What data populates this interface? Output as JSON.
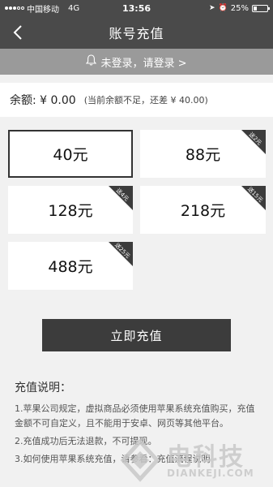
{
  "status_bar": {
    "carrier": "中国移动",
    "network": "4G",
    "time": "13:56",
    "battery": "25%",
    "battery_level": 0.25
  },
  "nav": {
    "title": "账号充值",
    "back_icon": "chevron-left-icon"
  },
  "login_banner": {
    "icon": "bell-icon",
    "text": "未登录，请登录 >"
  },
  "balance": {
    "label": "余额: ¥ 0.00",
    "note": "(当前余额不足，还差 ¥ 40.00)"
  },
  "options": [
    {
      "amount": "40元",
      "tag": "",
      "selected": true
    },
    {
      "amount": "88元",
      "tag": "送2元",
      "selected": false
    },
    {
      "amount": "128元",
      "tag": "送4元",
      "selected": false
    },
    {
      "amount": "218元",
      "tag": "送15元",
      "selected": false
    },
    {
      "amount": "488元",
      "tag": "送25元",
      "selected": false
    }
  ],
  "recharge_button": "立即充值",
  "instructions": {
    "heading": "充值说明：",
    "items": [
      "1.苹果公司规定，虚拟商品必须使用苹果系统充值购买，充值金额不可自定义，且不能用于安卓、网页等其他平台。",
      "2.充值成功后无法退款，不可提现。",
      "3.如何使用苹果系统充值，请参看：充值流程说明"
    ]
  },
  "watermark": {
    "text": "电科技",
    "subtext": "DIANKEJI.COM"
  }
}
